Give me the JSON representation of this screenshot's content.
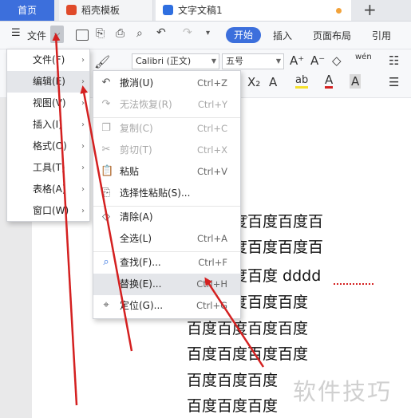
{
  "tabs": {
    "home": "首页",
    "template": "稻壳模板",
    "document": "文字文稿1",
    "new_tab": "+"
  },
  "toolbar": {
    "file_label": "文件",
    "start_label": "开始",
    "insert_label": "插入",
    "layout_label": "页面布局",
    "reference_label": "引用"
  },
  "ribbon": {
    "font_name": "Calibri (正文)",
    "font_size": "五号"
  },
  "main_menu": {
    "items": [
      {
        "label": "文件(F)"
      },
      {
        "label": "编辑(E)"
      },
      {
        "label": "视图(V)"
      },
      {
        "label": "插入(I)"
      },
      {
        "label": "格式(O)"
      },
      {
        "label": "工具(T)"
      },
      {
        "label": "表格(A)"
      },
      {
        "label": "窗口(W)"
      }
    ]
  },
  "edit_menu": {
    "items": [
      {
        "label": "撤消(U)",
        "shortcut": "Ctrl+Z",
        "icon": "undo-icon",
        "disabled": false
      },
      {
        "label": "无法恢复(R)",
        "shortcut": "Ctrl+Y",
        "icon": "redo-icon",
        "disabled": true
      },
      {
        "label": "复制(C)",
        "shortcut": "Ctrl+C",
        "icon": "copy-icon",
        "disabled": true
      },
      {
        "label": "剪切(T)",
        "shortcut": "Ctrl+X",
        "icon": "scissors-icon",
        "disabled": true
      },
      {
        "label": "粘贴",
        "shortcut": "Ctrl+V",
        "icon": "paste-icon",
        "disabled": false
      },
      {
        "label": "选择性粘贴(S)...",
        "shortcut": "",
        "icon": "paste-special-icon",
        "disabled": false
      },
      {
        "label": "清除(A)",
        "shortcut": "",
        "icon": "eraser-icon",
        "disabled": false
      },
      {
        "label": "全选(L)",
        "shortcut": "Ctrl+A",
        "icon": "",
        "disabled": false
      },
      {
        "label": "查找(F)...",
        "shortcut": "Ctrl+F",
        "icon": "search-icon",
        "disabled": false
      },
      {
        "label": "替换(E)...",
        "shortcut": "Ctrl+H",
        "icon": "",
        "disabled": false
      },
      {
        "label": "定位(G)...",
        "shortcut": "Ctrl+G",
        "icon": "locate-icon",
        "disabled": false
      }
    ]
  },
  "document": {
    "lines": [
      "百度百度百度百度百",
      "百度百度百度百度百",
      "百度百度百度 dddd",
      "百度百度百度百度",
      "百度百度百度百度",
      "百度百度百度百度",
      "百度百度百度",
      "百度百度百度"
    ]
  },
  "watermark": "软件技巧",
  "colors": {
    "accent": "#3c6fdc",
    "arrow": "#d42020"
  }
}
